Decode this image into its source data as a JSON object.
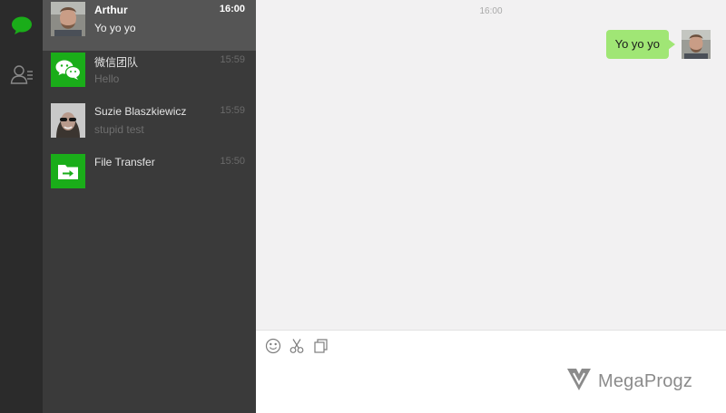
{
  "sidebar_nav": {
    "items": [
      {
        "name": "chats",
        "icon": "chat-bubble-icon",
        "active": true
      },
      {
        "name": "contacts",
        "icon": "contacts-icon",
        "active": false
      }
    ]
  },
  "conversations": [
    {
      "name": "Arthur",
      "last_message": "Yo yo yo",
      "time": "16:00",
      "active": true,
      "avatar": "arthur-avatar"
    },
    {
      "name": "微信团队",
      "last_message": "Hello",
      "time": "15:59",
      "active": false,
      "avatar": "wechat-team-logo"
    },
    {
      "name": "Suzie Blaszkiewicz",
      "last_message": "stupid test",
      "time": "15:59",
      "active": false,
      "avatar": "suzie-avatar"
    },
    {
      "name": "File Transfer",
      "last_message": "",
      "time": "15:50",
      "active": false,
      "avatar": "file-transfer-icon"
    }
  ],
  "chat": {
    "timestamp": "16:00",
    "messages": [
      {
        "from": "me",
        "text": "Yo yo yo"
      }
    ]
  },
  "composer": {
    "tools": [
      "emoji-icon",
      "scissors-icon",
      "copy-icon"
    ]
  },
  "watermark": {
    "text": "MegaProgz"
  },
  "colors": {
    "nav_bg": "#2b2b2b",
    "list_bg": "#3a3a3a",
    "active_row": "#555555",
    "wechat_green": "#1aad19",
    "bubble_green": "#a0e675",
    "chat_bg": "#f2f1f2"
  }
}
